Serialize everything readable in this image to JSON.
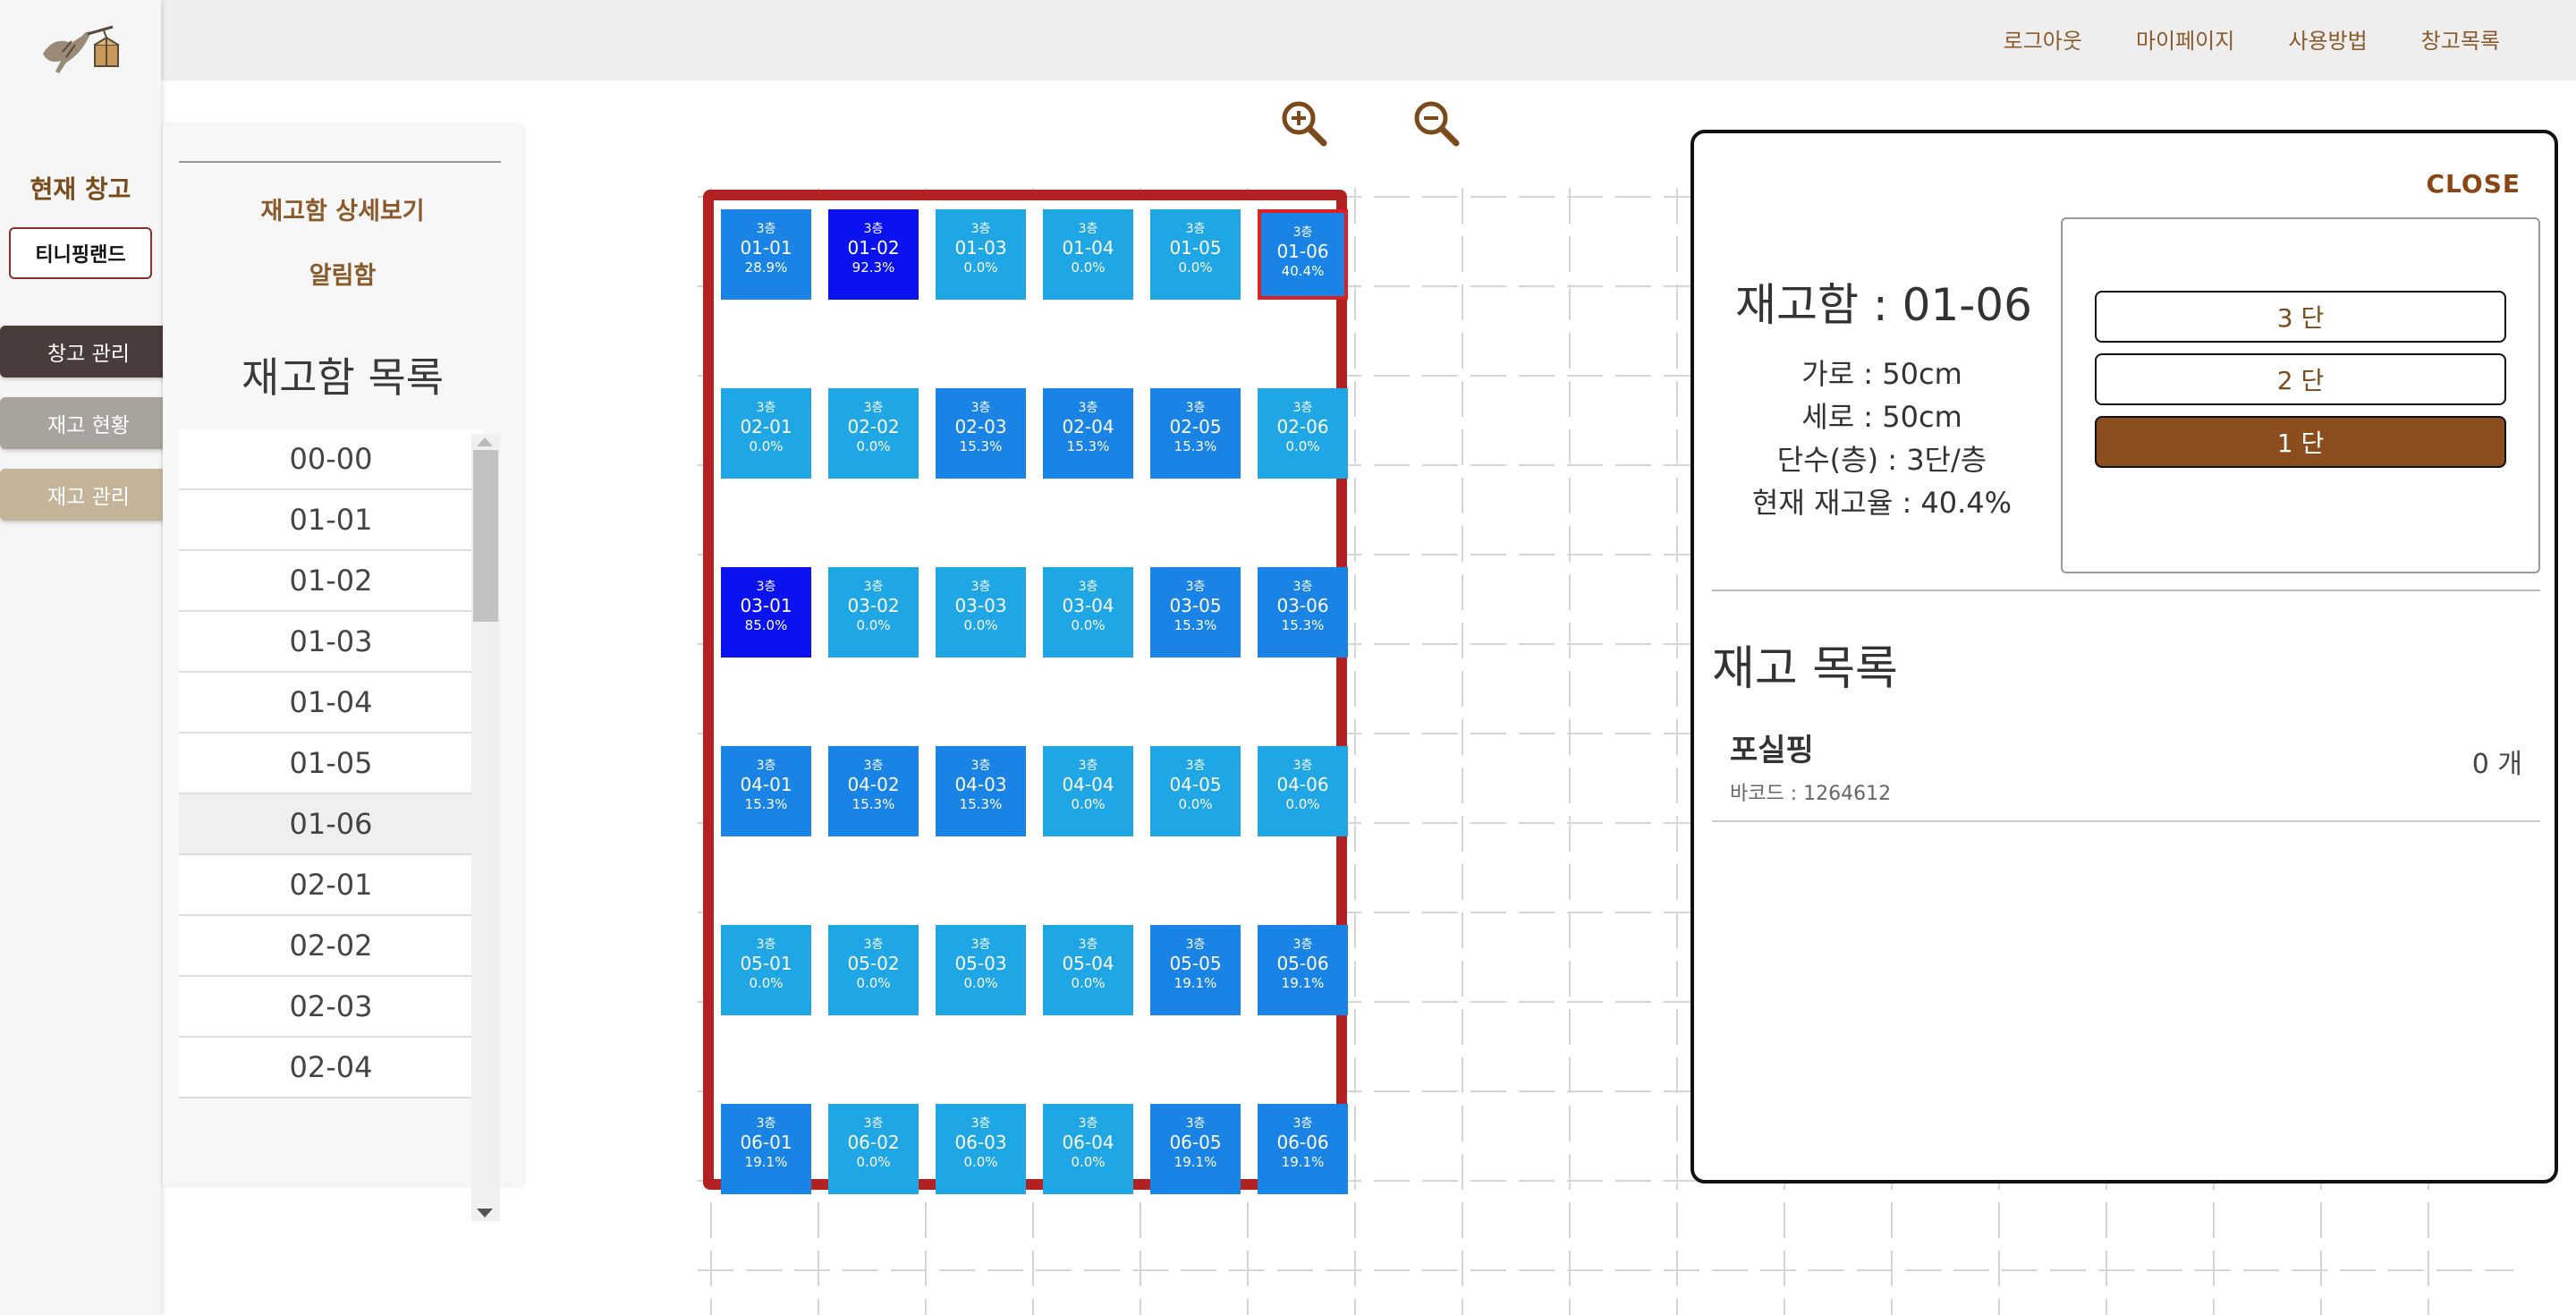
{
  "nav": {
    "items": [
      "로그아웃",
      "마이페이지",
      "사용방법",
      "창고목록"
    ]
  },
  "sidebar": {
    "current_warehouse_label": "현재 창고",
    "warehouse_name": "티니핑랜드",
    "menu": [
      {
        "label": "창고 관리",
        "color": "#4a3c3a"
      },
      {
        "label": "재고 현황",
        "color": "#a8a39d"
      },
      {
        "label": "재고 관리",
        "color": "#c4b59a"
      }
    ]
  },
  "list_panel": {
    "links": [
      "재고함 상세보기",
      "알림함"
    ],
    "title": "재고함 목록",
    "items": [
      "00-00",
      "01-01",
      "01-02",
      "01-03",
      "01-04",
      "01-05",
      "01-06",
      "02-01",
      "02-02",
      "02-03",
      "02-04"
    ],
    "selected": "01-06"
  },
  "grid": {
    "floor_label": "3층",
    "selected": "01-06",
    "colors": {
      "light": "#1ea7e4",
      "mid": "#1a84e6",
      "dark": "#0a12f0"
    },
    "rows": [
      [
        {
          "id": "01-01",
          "pct": "28.9%",
          "level": "mid"
        },
        {
          "id": "01-02",
          "pct": "92.3%",
          "level": "dark"
        },
        {
          "id": "01-03",
          "pct": "0.0%",
          "level": "light"
        },
        {
          "id": "01-04",
          "pct": "0.0%",
          "level": "light"
        },
        {
          "id": "01-05",
          "pct": "0.0%",
          "level": "light"
        },
        {
          "id": "01-06",
          "pct": "40.4%",
          "level": "mid"
        }
      ],
      [
        {
          "id": "02-01",
          "pct": "0.0%",
          "level": "light"
        },
        {
          "id": "02-02",
          "pct": "0.0%",
          "level": "light"
        },
        {
          "id": "02-03",
          "pct": "15.3%",
          "level": "mid"
        },
        {
          "id": "02-04",
          "pct": "15.3%",
          "level": "mid"
        },
        {
          "id": "02-05",
          "pct": "15.3%",
          "level": "mid"
        },
        {
          "id": "02-06",
          "pct": "0.0%",
          "level": "light"
        }
      ],
      [
        {
          "id": "03-01",
          "pct": "85.0%",
          "level": "dark"
        },
        {
          "id": "03-02",
          "pct": "0.0%",
          "level": "light"
        },
        {
          "id": "03-03",
          "pct": "0.0%",
          "level": "light"
        },
        {
          "id": "03-04",
          "pct": "0.0%",
          "level": "light"
        },
        {
          "id": "03-05",
          "pct": "15.3%",
          "level": "mid"
        },
        {
          "id": "03-06",
          "pct": "15.3%",
          "level": "mid"
        }
      ],
      [
        {
          "id": "04-01",
          "pct": "15.3%",
          "level": "mid"
        },
        {
          "id": "04-02",
          "pct": "15.3%",
          "level": "mid"
        },
        {
          "id": "04-03",
          "pct": "15.3%",
          "level": "mid"
        },
        {
          "id": "04-04",
          "pct": "0.0%",
          "level": "light"
        },
        {
          "id": "04-05",
          "pct": "0.0%",
          "level": "light"
        },
        {
          "id": "04-06",
          "pct": "0.0%",
          "level": "light"
        }
      ],
      [
        {
          "id": "05-01",
          "pct": "0.0%",
          "level": "light"
        },
        {
          "id": "05-02",
          "pct": "0.0%",
          "level": "light"
        },
        {
          "id": "05-03",
          "pct": "0.0%",
          "level": "light"
        },
        {
          "id": "05-04",
          "pct": "0.0%",
          "level": "light"
        },
        {
          "id": "05-05",
          "pct": "19.1%",
          "level": "mid"
        },
        {
          "id": "05-06",
          "pct": "19.1%",
          "level": "mid"
        }
      ],
      [
        {
          "id": "06-01",
          "pct": "19.1%",
          "level": "mid"
        },
        {
          "id": "06-02",
          "pct": "0.0%",
          "level": "light"
        },
        {
          "id": "06-03",
          "pct": "0.0%",
          "level": "light"
        },
        {
          "id": "06-04",
          "pct": "0.0%",
          "level": "light"
        },
        {
          "id": "06-05",
          "pct": "19.1%",
          "level": "mid"
        },
        {
          "id": "06-06",
          "pct": "19.1%",
          "level": "mid"
        }
      ]
    ]
  },
  "zoom": {
    "in_icon": "zoom-in-icon",
    "out_icon": "zoom-out-icon"
  },
  "detail": {
    "close_label": "CLOSE",
    "title": "재고함 : 01-06",
    "info": [
      "가로 : 50cm",
      "세로 : 50cm",
      "단수(층) : 3단/층",
      "현재 재고율 : 40.4%"
    ],
    "tiers": [
      {
        "label": "3 단",
        "active": false
      },
      {
        "label": "2 단",
        "active": false
      },
      {
        "label": "1 단",
        "active": true
      }
    ],
    "tier_active_color": "#8B4D1E",
    "inventory_title": "재고 목록",
    "inventory": [
      {
        "name": "포실핑",
        "barcode": "바코드 : 1264612",
        "qty": "0 개"
      }
    ]
  }
}
